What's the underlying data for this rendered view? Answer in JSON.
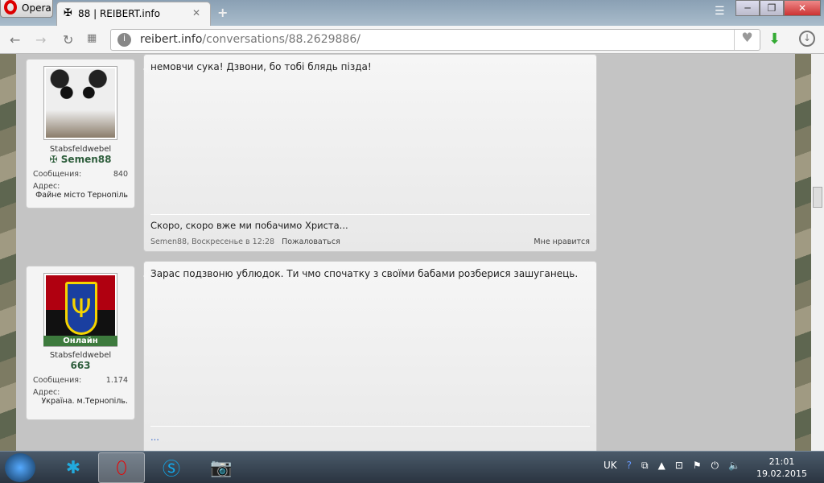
{
  "browser": {
    "menu_label": "Opera",
    "tab_title": "88 | REIBERT.info",
    "url_host": "reibert.info",
    "url_path": "/conversations/88.2629886/"
  },
  "posts": [
    {
      "rank": "Stabsfeldwebel",
      "username": "Semen88",
      "stats_label_messages": "Сообщения:",
      "messages": "840",
      "stats_label_address": "Адрес:",
      "address": "Файне місто Тернопіль",
      "text": "немовчи сука! Дзвони, бо тобі блядь пізда!",
      "signature": "Скоро, скоро вже ми побачимо Христа...",
      "meta": "Semen88, Воскресенье в 12:28",
      "report": "Пожаловаться",
      "like": "Мне нравится"
    },
    {
      "rank": "Stabsfeldwebel",
      "username": "663",
      "online": "Онлайн",
      "stats_label_messages": "Сообщения:",
      "messages": "1.174",
      "stats_label_address": "Адрес:",
      "address": "Україна. м.Тернопіль.",
      "text": "Зарас подзвоню ублюдок. Ти чмо спочатку з своїми бабами розберися зашуганець.",
      "signature": "..."
    }
  ],
  "taskbar": {
    "lang": "UK",
    "time": "21:01",
    "date": "19.02.2015"
  }
}
